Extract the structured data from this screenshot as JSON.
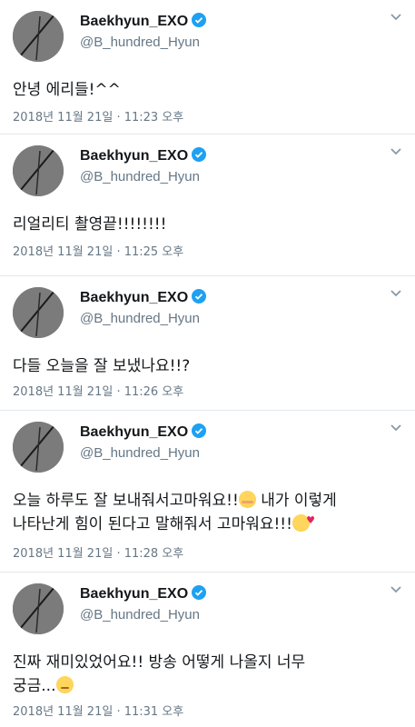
{
  "tweets": [
    {
      "display_name": "Baekhyun_EXO",
      "handle": "@B_hundred_Hyun",
      "text": "안녕 에리들!^^",
      "emoji": [],
      "timestamp": "2018년 11월 21일 · 11:23 오후"
    },
    {
      "display_name": "Baekhyun_EXO",
      "handle": "@B_hundred_Hyun",
      "text": "리얼리티 촬영끝!!!!!!!!",
      "emoji": [],
      "timestamp": "2018년 11월 21일 · 11:25 오후"
    },
    {
      "display_name": "Baekhyun_EXO",
      "handle": "@B_hundred_Hyun",
      "text": "다들 오늘을 잘 보냈나요!!?",
      "emoji": [],
      "timestamp": "2018년 11월 21일 · 11:26 오후"
    },
    {
      "display_name": "Baekhyun_EXO",
      "handle": "@B_hundred_Hyun",
      "text_parts": [
        "오늘 하루도 잘 보내줘서고마워요!!",
        " 내가 이렇게\n나타난게 힘이 된다고 말해줘서 고마워요!!!"
      ],
      "emoji": [
        "smiling-face-with-blush-emoji",
        "smiling-face-with-hearts-emoji"
      ],
      "timestamp": "2018년 11월 21일 · 11:28 오후"
    },
    {
      "display_name": "Baekhyun_EXO",
      "handle": "@B_hundred_Hyun",
      "text": "진짜 재미있었어요!! 방송 어떻게 나올지 너무\n궁금...",
      "emoji": [
        "relieved-face-emoji"
      ],
      "timestamp": "2018년 11월 21일 · 11:31 오후"
    }
  ],
  "icons": {
    "verified": "verified-badge-icon",
    "menu": "chevron-down-icon"
  },
  "colors": {
    "verified_blue": "#1da1f2",
    "secondary_text": "#657786",
    "divider": "#e1e8ed"
  }
}
